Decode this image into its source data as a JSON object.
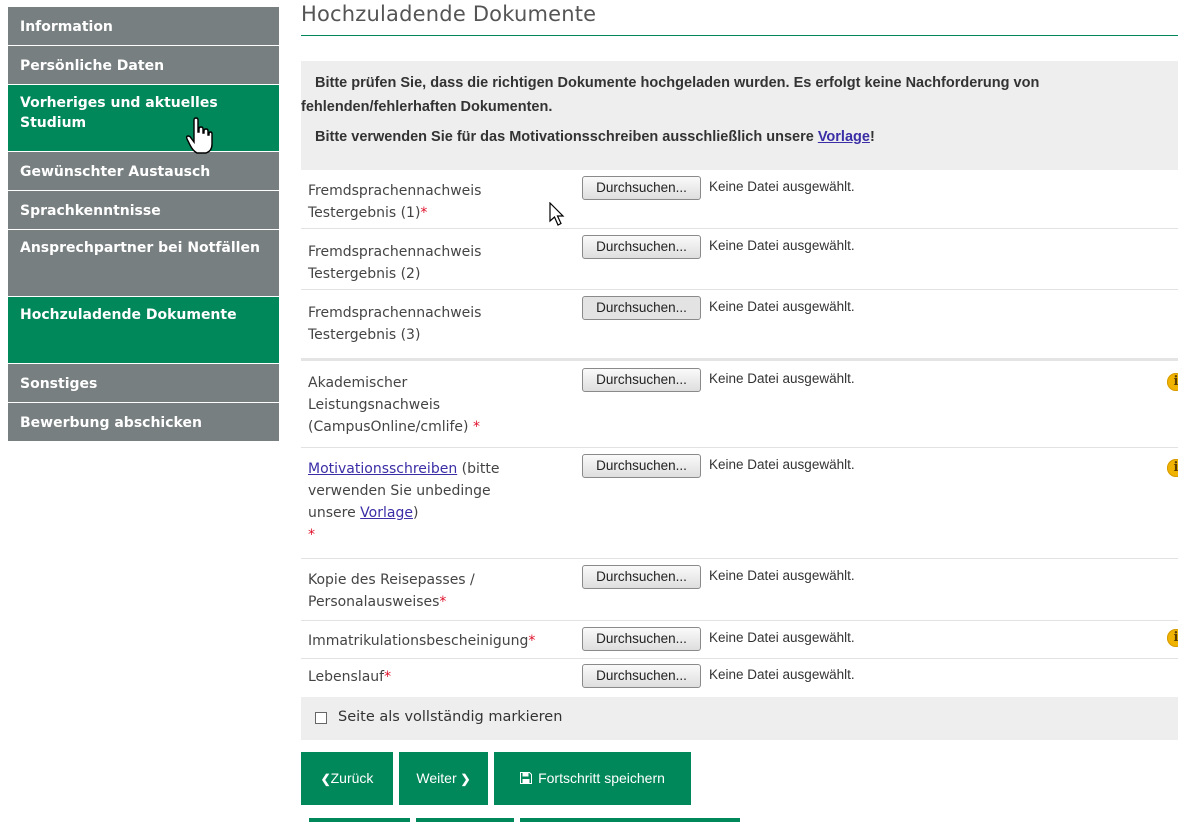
{
  "sidebar": {
    "items": [
      {
        "label": "Information",
        "active": false
      },
      {
        "label": "Persönliche Daten",
        "active": false
      },
      {
        "label": "Vorheriges und aktuelles Studium",
        "active": true
      },
      {
        "label": "Gewünschter Austausch",
        "active": false
      },
      {
        "label": "Sprachkenntnisse",
        "active": false
      },
      {
        "label": "Ansprechpartner bei Notfällen",
        "active": false
      },
      {
        "label": "Hochzuladende Dokumente",
        "active": true
      },
      {
        "label": "Sonstiges",
        "active": false
      },
      {
        "label": "Bewerbung abschicken",
        "active": false
      }
    ]
  },
  "main": {
    "title": "Hochzuladende Dokumente",
    "notice": {
      "line1": "Bitte prüfen Sie, dass die richtigen Dokumente hochgeladen wurden. Es erfolgt keine Nachforderung von",
      "line2": "fehlenden/fehlerhaften Dokumenten.",
      "line3_pre": "Bitte verwenden Sie für das Motivationsschreiben ausschließlich unsere ",
      "line3_link": "Vorlage",
      "line3_post": "!"
    },
    "browse_label": "Durchsuchen...",
    "no_file_label": "Keine Datei ausgewählt.",
    "required_mark": "*",
    "info_glyph": "i",
    "uploads": [
      {
        "label": "Fremdsprachennachweis Testergebnis (1)",
        "required": true
      },
      {
        "label": "Fremdsprachennachweis Testergebnis (2)",
        "required": false
      },
      {
        "label": "Fremdsprachennachweis Testergebnis (3)",
        "required": false
      },
      {
        "label": "Akademischer Leistungsnachweis (CampusOnline/cmlife)",
        "required": true,
        "info": true
      },
      {
        "label_link": "Motivationsschreiben",
        "label_mid": " (bitte verwenden Sie unbedinge unsere ",
        "label_link2": "Vorlage",
        "label_end": ")",
        "required": true,
        "info": true
      },
      {
        "label": "Kopie des Reisepasses / Personalausweises",
        "required": true
      },
      {
        "label": "Immatrikulationsbescheinigung",
        "required": true,
        "info": true
      },
      {
        "label": "Lebenslauf",
        "required": true
      }
    ],
    "complete_label": "Seite als vollständig markieren",
    "buttons": {
      "back": "Zurück",
      "next": "Weiter",
      "save": "Fortschritt speichern"
    }
  },
  "colors": {
    "accent": "#00875a",
    "sidebar_inactive": "#787f80",
    "info_icon": "#f0b400",
    "required": "#e0102a",
    "link": "#3a2ea6"
  },
  "icons": {
    "back": "chevron-left-icon",
    "next": "chevron-right-icon",
    "save": "floppy-disk-icon",
    "info": "info-icon"
  }
}
